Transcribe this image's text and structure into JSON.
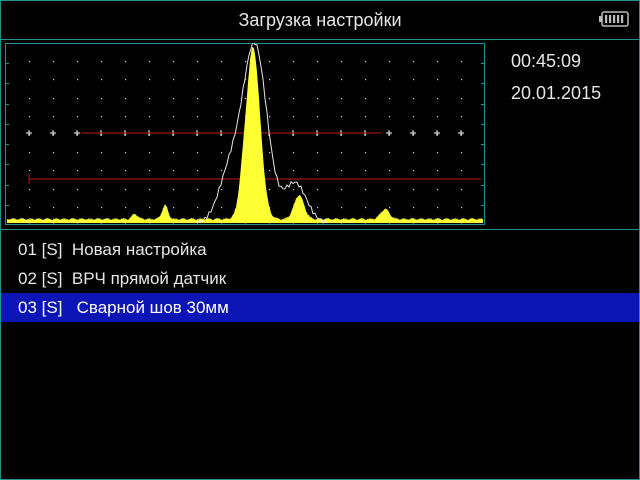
{
  "header": {
    "title": "Загрузка настройки"
  },
  "status": {
    "time": "00:45:09",
    "date": "20.01.2015"
  },
  "settings": {
    "items": [
      {
        "label": "01 [S]  Новая настройка"
      },
      {
        "label": "02 [S]  ВРЧ прямой датчик"
      },
      {
        "label": "03 [S]   Сварной шов 30мм"
      }
    ],
    "selected_index": 2
  },
  "colors": {
    "frame": "#1f8f8f",
    "signal_fill": "#ffff33",
    "envelope": "#e8e8e8",
    "gate": "#c01818",
    "grid_marks": "#ffffff",
    "selection": "#0b14b4"
  },
  "icons": {
    "battery": "battery-full-icon"
  }
}
